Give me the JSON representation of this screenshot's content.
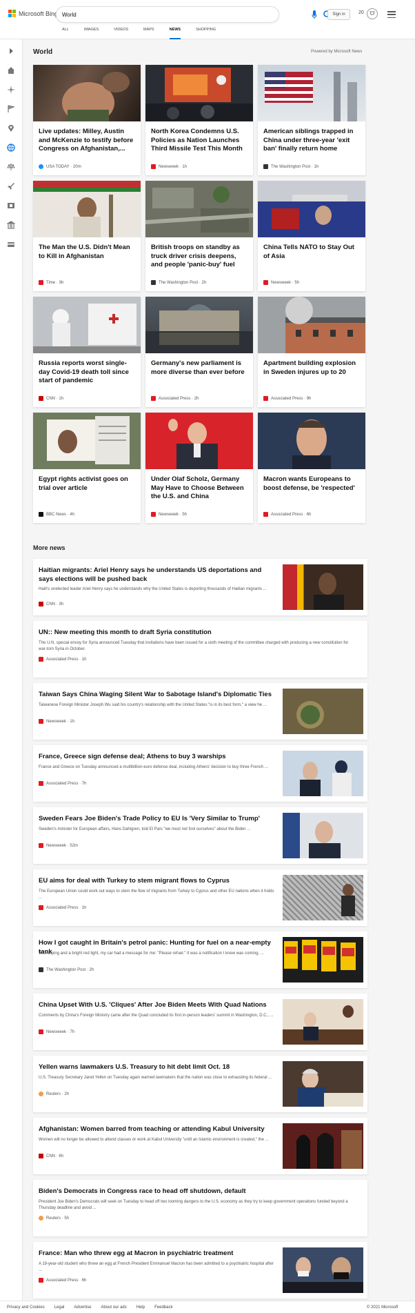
{
  "header": {
    "brand": "Microsoft Bing",
    "search_value": "World",
    "signin": "Sign in",
    "points": "20"
  },
  "tabs": [
    "ALL",
    "IMAGES",
    "VIDEOS",
    "MAPS",
    "NEWS",
    "SHOPPING"
  ],
  "active_tab": "NEWS",
  "section": {
    "title": "World",
    "powered": "Powered by Microsoft News"
  },
  "cards": [
    {
      "title": "Live updates: Milley, Austin and McKenzie to testify before Congress on Afghanistan,...",
      "source": "USA TODAY",
      "time": "20m",
      "src_color": "#1a90ff"
    },
    {
      "title": "North Korea Condemns U.S. Policies as Nation Launches Third Missile Test This Month",
      "source": "Newsweek",
      "time": "1h",
      "src_color": "#e01b24"
    },
    {
      "title": "American siblings trapped in China under three-year 'exit ban' finally return home",
      "source": "The Washington Post",
      "time": "1h",
      "src_color": "#333"
    },
    {
      "title": "The Man the U.S. Didn't Mean to Kill in Afghanistan",
      "source": "Time",
      "time": "3h",
      "src_color": "#e01b24"
    },
    {
      "title": "British troops on standby as truck driver crisis deepens, and people 'panic-buy' fuel",
      "source": "The Washington Post",
      "time": "2h",
      "src_color": "#333"
    },
    {
      "title": "China Tells NATO to Stay Out of Asia",
      "source": "Newsweek",
      "time": "5h",
      "src_color": "#e01b24"
    },
    {
      "title": "Russia reports worst single-day Covid-19 death toll since start of pandemic",
      "source": "CNN",
      "time": "1h",
      "src_color": "#cc0000"
    },
    {
      "title": "Germany's new parliament is more diverse than ever before",
      "source": "Associated Press",
      "time": "2h",
      "src_color": "#e01b24"
    },
    {
      "title": "Apartment building explosion in Sweden injures up to 20",
      "source": "Associated Press",
      "time": "9h",
      "src_color": "#e01b24"
    },
    {
      "title": "Egypt rights activist goes on trial over article",
      "source": "BBC News",
      "time": "4h",
      "src_color": "#111"
    },
    {
      "title": "Under Olaf Scholz, Germany May Have to Choose Between the U.S. and China",
      "source": "Newsweek",
      "time": "5h",
      "src_color": "#e01b24"
    },
    {
      "title": "Macron wants Europeans to boost defense, be 'respected'",
      "source": "Associated Press",
      "time": "6h",
      "src_color": "#e01b24"
    }
  ],
  "more_news_title": "More news",
  "more_news": [
    {
      "title": "Haitian migrants: Ariel Henry says he understands US deportations and says elections will be pushed back",
      "desc": "Haiti's unelected leader Ariel Henry says he understands why the United States is deporting thousands of Haitian migrants ...",
      "source": "CNN",
      "time": "3h",
      "src_color": "#cc0000",
      "has_thumb": true
    },
    {
      "title": "UN:: New meeting this month to draft Syria constitution",
      "desc": "The U.N. special envoy for Syria announced Tuesday that invitations have been issued for a sixth meeting of the committee charged with producing a new constitution for war-torn Syria in October.",
      "source": "Associated Press",
      "time": "1h",
      "src_color": "#e01b24",
      "has_thumb": false
    },
    {
      "title": "Taiwan Says China Waging Silent War to Sabotage Island's Diplomatic Ties",
      "desc": "Taiwanese Foreign Minister Joseph Wu said his country's relationship with the United States \"is in its best form,\" a view he ...",
      "source": "Newsweek",
      "time": "1h",
      "src_color": "#e01b24",
      "has_thumb": true
    },
    {
      "title": "France, Greece sign defense deal; Athens to buy 3 warships",
      "desc": "France and Greece on Tuesday announced a multibillion-euro defense deal, including Athens' decision to buy three French ...",
      "source": "Associated Press",
      "time": "7h",
      "src_color": "#e01b24",
      "has_thumb": true
    },
    {
      "title": "Sweden Fears Joe Biden's Trade Policy to EU Is 'Very Similar to Trump'",
      "desc": "Sweden's minister for European affairs, Hans Dahlgren, told El País \"we must not fool ourselves\" about the Biden ...",
      "source": "Newsweek",
      "time": "52m",
      "src_color": "#e01b24",
      "has_thumb": true
    },
    {
      "title": "EU aims for deal with Turkey to stem migrant flows to Cyprus",
      "desc": "The European Union could work out ways to stem the flow of migrants from Turkey to Cyprus and other EU nations when it holds ...",
      "source": "Associated Press",
      "time": "1h",
      "src_color": "#e01b24",
      "has_thumb": true
    },
    {
      "title": "How I got caught in Britain's petrol panic: Hunting for fuel on a near-empty tank",
      "desc": "With a ping and a bright red light, my car had a message for me: \"Please refuel.\" It was a notification I knew was coming, ...",
      "source": "The Washington Post",
      "time": "2h",
      "src_color": "#333",
      "has_thumb": true
    },
    {
      "title": "China Upset With U.S. 'Cliques' After Joe Biden Meets With Quad Nations",
      "desc": "Comments by China's Foreign Ministry came after the Quad concluded its first in-person leaders' summit in Washington, D.C., ...",
      "source": "Newsweek",
      "time": "7h",
      "src_color": "#e01b24",
      "has_thumb": true
    },
    {
      "title": "Yellen warns lawmakers U.S. Treasury to hit debt limit Oct. 18",
      "desc": "U.S. Treasury Secretary Janet Yellen on Tuesday again warned lawmakers that the nation was close to exhausting its federal ...",
      "source": "Reuters",
      "time": "2h",
      "src_color": "#f39c4a",
      "has_thumb": true
    },
    {
      "title": "Afghanistan: Women barred from teaching or attending Kabul University",
      "desc": "Women will no longer be allowed to attend classes or work at Kabul University \"until an Islamic environment is created,\" the ...",
      "source": "CNN",
      "time": "6h",
      "src_color": "#cc0000",
      "has_thumb": true
    },
    {
      "title": "Biden's Democrats in Congress race to head off shutdown, default",
      "desc": "President Joe Biden's Democrats will seek on Tuesday to head off two looming dangers to the U.S. economy as they try to keep government operations funded beyond a Thursday deadline and avoid ...",
      "source": "Reuters",
      "time": "5h",
      "src_color": "#f39c4a",
      "has_thumb": false
    },
    {
      "title": "France: Man who threw egg at Macron in psychiatric treatment",
      "desc": "A 19-year-old student who threw an egg at French President Emmanuel Macron has been admitted to a psychiatric hospital after ...",
      "source": "Associated Press",
      "time": "6h",
      "src_color": "#e01b24",
      "has_thumb": true
    }
  ],
  "footer": {
    "links": [
      "Privacy and Cookies",
      "Legal",
      "Advertise",
      "About our ads",
      "Help",
      "Feedback"
    ],
    "copyright": "© 2021 Microsoft"
  },
  "icons": [
    "expand-icon",
    "home-icon",
    "sparkle-icon",
    "flag-icon",
    "location-icon",
    "globe-icon",
    "balance-icon",
    "rocket-icon",
    "film-icon",
    "bank-icon",
    "card-icon"
  ]
}
